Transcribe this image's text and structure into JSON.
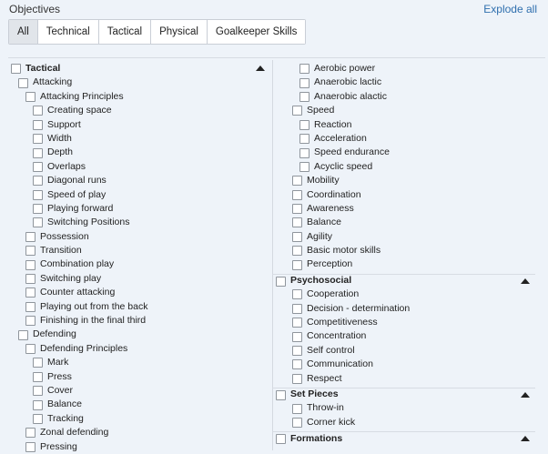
{
  "header": {
    "title": "Objectives",
    "explode": "Explode all"
  },
  "tabs": [
    "All",
    "Technical",
    "Tactical",
    "Physical",
    "Goalkeeper Skills"
  ],
  "left": [
    {
      "label": "Tactical",
      "level": 0,
      "section": true,
      "caret": true
    },
    {
      "label": "Attacking",
      "level": 1
    },
    {
      "label": "Attacking Principles",
      "level": 2
    },
    {
      "label": "Creating space",
      "level": 3
    },
    {
      "label": "Support",
      "level": 3
    },
    {
      "label": "Width",
      "level": 3
    },
    {
      "label": "Depth",
      "level": 3
    },
    {
      "label": "Overlaps",
      "level": 3
    },
    {
      "label": "Diagonal runs",
      "level": 3
    },
    {
      "label": "Speed of play",
      "level": 3
    },
    {
      "label": "Playing forward",
      "level": 3
    },
    {
      "label": "Switching Positions",
      "level": 3
    },
    {
      "label": "Possession",
      "level": 2
    },
    {
      "label": "Transition",
      "level": 2
    },
    {
      "label": "Combination play",
      "level": 2
    },
    {
      "label": "Switching play",
      "level": 2
    },
    {
      "label": "Counter attacking",
      "level": 2
    },
    {
      "label": "Playing out from the back",
      "level": 2
    },
    {
      "label": "Finishing in the final third",
      "level": 2
    },
    {
      "label": "Defending",
      "level": 1
    },
    {
      "label": "Defending Principles",
      "level": 2
    },
    {
      "label": "Mark",
      "level": 3
    },
    {
      "label": "Press",
      "level": 3
    },
    {
      "label": "Cover",
      "level": 3
    },
    {
      "label": "Balance",
      "level": 3
    },
    {
      "label": "Tracking",
      "level": 3
    },
    {
      "label": "Zonal defending",
      "level": 2
    },
    {
      "label": "Pressing",
      "level": 2
    }
  ],
  "right": [
    {
      "label": "Aerobic power",
      "level": 2
    },
    {
      "label": "Anaerobic lactic",
      "level": 2
    },
    {
      "label": "Anaerobic alactic",
      "level": 2
    },
    {
      "label": "Speed",
      "level": 1
    },
    {
      "label": "Reaction",
      "level": 2
    },
    {
      "label": "Acceleration",
      "level": 2
    },
    {
      "label": "Speed endurance",
      "level": 2
    },
    {
      "label": "Acyclic speed",
      "level": 2
    },
    {
      "label": "Mobility",
      "level": 1
    },
    {
      "label": "Coordination",
      "level": 1
    },
    {
      "label": "Awareness",
      "level": 1
    },
    {
      "label": "Balance",
      "level": 1
    },
    {
      "label": "Agility",
      "level": 1
    },
    {
      "label": "Basic motor skills",
      "level": 1
    },
    {
      "label": "Perception",
      "level": 1
    },
    {
      "label": "Psychosocial",
      "level": 0,
      "section": true,
      "caret": true,
      "divider": true
    },
    {
      "label": "Cooperation",
      "level": 1
    },
    {
      "label": "Decision - determination",
      "level": 1
    },
    {
      "label": "Competitiveness",
      "level": 1
    },
    {
      "label": "Concentration",
      "level": 1
    },
    {
      "label": "Self control",
      "level": 1
    },
    {
      "label": "Communication",
      "level": 1
    },
    {
      "label": "Respect",
      "level": 1
    },
    {
      "label": "Set Pieces",
      "level": 0,
      "section": true,
      "caret": true,
      "divider": true
    },
    {
      "label": "Throw-in",
      "level": 1
    },
    {
      "label": "Corner kick",
      "level": 1
    },
    {
      "label": "Formations",
      "level": 0,
      "section": true,
      "caret": true,
      "divider": true
    }
  ]
}
